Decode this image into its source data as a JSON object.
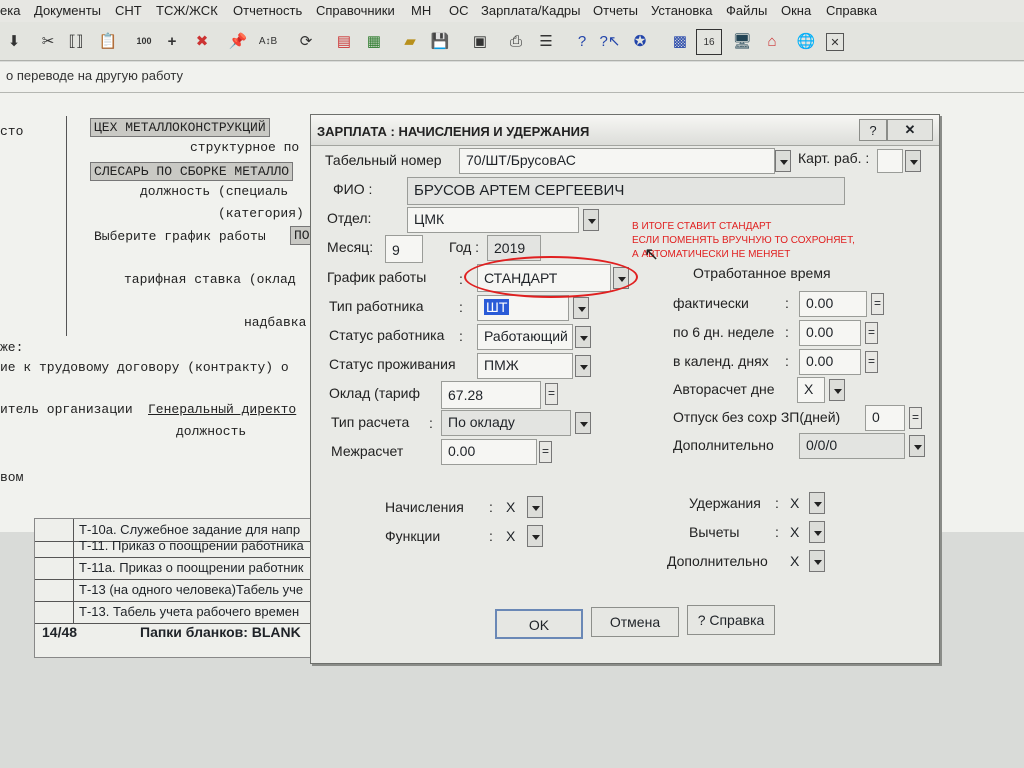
{
  "menu": [
    "ека",
    "Документы",
    "СНТ",
    "ТСЖ/ЖСК",
    "Отчетность",
    "Справочники",
    "МН",
    "ОС",
    "Зарплата/Кадры",
    "Отчеты",
    "Установка",
    "Файлы",
    "Окна",
    "Справка"
  ],
  "toolbar": {
    "icons": [
      "arrow-down-icon",
      "scissors-icon",
      "bracket-icon",
      "paste-icon",
      "counter-icon",
      "plus-icon",
      "delete-icon",
      "pin-icon",
      "sort-icon",
      "refresh-icon",
      "document-icon",
      "calculator-icon",
      "folder-icon",
      "save-icon",
      "frame-icon",
      "print-icon",
      "list-icon",
      "help-icon",
      "help-cursor-icon",
      "compass-icon",
      "grid-icon",
      "calendar-icon",
      "monitor-icon",
      "home-icon",
      "world-icon",
      "close-icon"
    ],
    "counter_label": "100",
    "calendar_label": "16"
  },
  "background": {
    "window_title": "о переводе на другую работу",
    "left_fragments": [
      "сто",
      "же:",
      "ие к трудовому договору (контракту) о",
      "итель организации",
      "вом"
    ],
    "dept": "ЦЕХ МЕТАЛЛОКОНСТРУКЦИЙ",
    "struct_sub": "структурное по",
    "position": "СЛЕСАРЬ ПО СБОРКЕ МЕТАЛЛО",
    "position_sub": "должность (специаль",
    "category_sub": "(категория)",
    "schedule_prompt": "Выберите график работы",
    "schedule_value": "ПО",
    "rate_label": "тарифная ставка  (оклад",
    "bonus_label": "надбавка",
    "director": "Генеральный директо",
    "director_sub": "должность",
    "list": [
      "Т-10а. Служебное задание для напр",
      "Т-11. Приказ о поощрении работника",
      "Т-11а. Приказ о поощрении работник",
      "Т-13 (на одного человека)Табель уче",
      "Т-13. Табель учета рабочего времен"
    ],
    "status_count": "14/48",
    "status_text": "Папки бланков: BLANK"
  },
  "dialog": {
    "title": "ЗАРПЛАТА : НАЧИСЛЕНИЯ И УДЕРЖАНИЯ",
    "tabnum_label": "Табельный номер",
    "tabnum_value": "70/ШТ/БрусовАС",
    "kart_label": "Карт. раб. :",
    "fio_label": "ФИО :",
    "fio_value": "БРУСОВ АРТЕМ СЕРГЕЕВИЧ",
    "dept_label": "Отдел:",
    "dept_value": "ЦМК",
    "month_label": "Месяц:",
    "month_value": "9",
    "year_label": "Год :",
    "year_value": "2019",
    "schedule_label": "График работы",
    "colon": ":",
    "schedule_value": "СТАНДАРТ",
    "worker_type_label": "Тип работника",
    "worker_type_value": "ШТ",
    "worker_status_label": "Статус работника",
    "worker_status_value": "Работающий",
    "residence_label": "Статус проживания",
    "residence_value": "ПМЖ",
    "salary_label": "Оклад (тариф",
    "salary_value": "67.28",
    "calc_type_label": "Тип расчета",
    "calc_type_value": "По окладу",
    "intercalc_label": "Межрасчет",
    "intercalc_value": "0.00",
    "worked_title": "Отработанное время",
    "actual_label": "фактически",
    "actual_value": "0.00",
    "six_day_label": "по 6 дн. неделе",
    "six_day_value": "0.00",
    "calendar_label": "в календ. днях",
    "calendar_value": "0.00",
    "autocalc_label": "Авторасчет дне",
    "autocalc_value": "X",
    "unpaid_label": "Отпуск без сохр ЗП(дней)",
    "unpaid_value": "0",
    "extra_label": "Дополнительно",
    "extra_value": "0/0/0",
    "accruals_label": "Начисления",
    "accruals_value": "X",
    "functions_label": "Функции",
    "functions_value": "X",
    "deductions_label": "Удержания",
    "deductions_value": "X",
    "withholdings_label": "Вычеты",
    "withholdings_value": "X",
    "extra2_label": "Дополнительно",
    "extra2_value": "X",
    "ok": "OK",
    "cancel": "Отмена",
    "help": "? Справка",
    "eq": "="
  },
  "annotation": {
    "lines": [
      "В ИТОГЕ СТАВИТ СТАНДАРТ",
      "ЕСЛИ ПОМЕНЯТЬ ВРУЧНУЮ ТО СОХРОНЯЕТ,",
      "А АВТОМАТИЧЕСКИ НЕ МЕНЯЕТ"
    ],
    "color": "#e02020"
  }
}
